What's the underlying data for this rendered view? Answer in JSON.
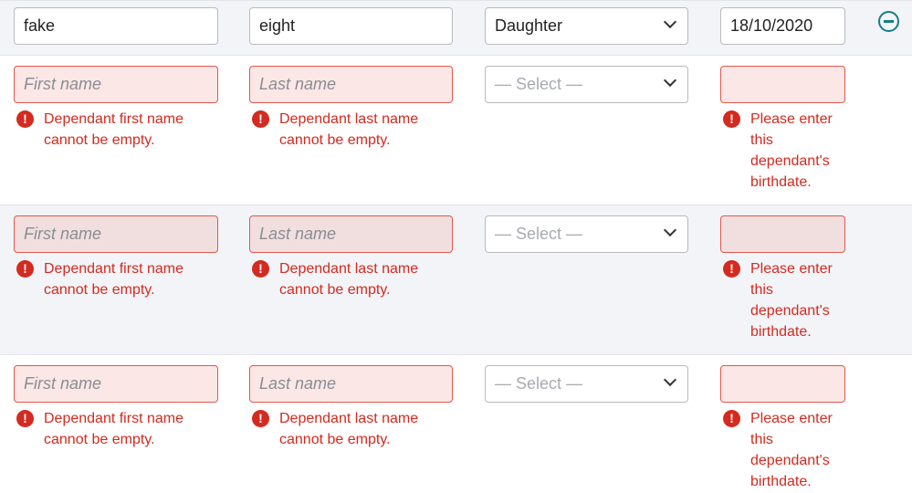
{
  "rows": [
    {
      "first_name": "fake",
      "last_name": "eight",
      "relationship": "Daughter",
      "birthdate": "18/10/2020"
    },
    {
      "first_name_placeholder": "First name",
      "last_name_placeholder": "Last name",
      "relationship_placeholder": "— Select —",
      "birthdate": "",
      "errors": {
        "first": "Dependant first name cannot be empty.",
        "last": "Dependant last name cannot be empty.",
        "birthdate": "Please enter this dependant's birthdate."
      }
    },
    {
      "first_name_placeholder": "First name",
      "last_name_placeholder": "Last name",
      "relationship_placeholder": "— Select —",
      "birthdate": "",
      "errors": {
        "first": "Dependant first name cannot be empty.",
        "last": "Dependant last name cannot be empty.",
        "birthdate": "Please enter this dependant's birthdate."
      }
    },
    {
      "first_name_placeholder": "First name",
      "last_name_placeholder": "Last name",
      "relationship_placeholder": "— Select —",
      "birthdate": "",
      "errors": {
        "first": "Dependant first name cannot be empty.",
        "last": "Dependant last name cannot be empty.",
        "birthdate": "Please enter this dependant's birthdate."
      }
    }
  ],
  "error_icon_glyph": "!",
  "colors": {
    "error": "#d42a1f",
    "accent": "#137f86",
    "error_bg": "#fbe7e6"
  }
}
